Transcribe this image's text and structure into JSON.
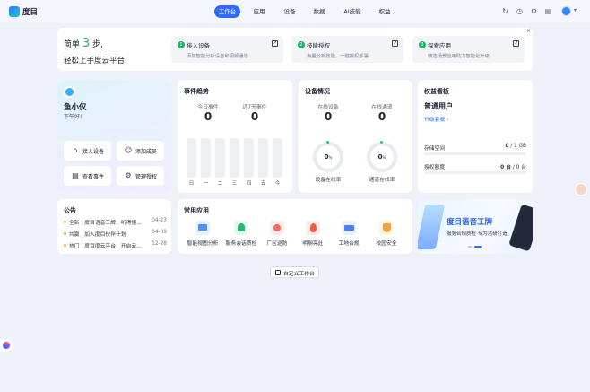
{
  "app": {
    "name": "度目"
  },
  "nav": {
    "items": [
      {
        "label": "工作台",
        "active": true
      },
      {
        "label": "应用"
      },
      {
        "label": "设备"
      },
      {
        "label": "数据"
      },
      {
        "label": "AI技能"
      },
      {
        "label": "权益"
      }
    ]
  },
  "onboarding": {
    "headline_pre": "简单",
    "headline_num": "3",
    "headline_post": "步,",
    "headline_line2": "轻松上手度云平台",
    "steps": [
      {
        "num": "1",
        "title": "接入设备",
        "desc": "添加智能分析设备和视频通道"
      },
      {
        "num": "2",
        "title": "技能授权",
        "desc": "海量分析技能，一键授权部署"
      },
      {
        "num": "3",
        "title": "探索应用",
        "desc": "精选场景应用助力智能化升级"
      }
    ]
  },
  "profile": {
    "name": "鱼小仅",
    "greeting": "下午好!",
    "buttons": [
      "接入设备",
      "添加成员",
      "查看事件",
      "管理授权"
    ]
  },
  "events": {
    "title": "事件趋势",
    "today_label": "今日事件",
    "today_value": "0",
    "week_label": "近7天事件",
    "week_value": "0",
    "days": [
      "日",
      "一",
      "二",
      "三",
      "四",
      "五",
      "今"
    ],
    "daily_counts": [
      0,
      0,
      0,
      0,
      0,
      0,
      0
    ]
  },
  "devices": {
    "title": "设备情况",
    "online_device_label": "在线设备",
    "online_device_value": "0",
    "online_channel_label": "在线通道",
    "online_channel_value": "0",
    "device_rate_value": "0",
    "device_rate_unit": "%",
    "device_rate_label": "设备在线率",
    "channel_rate_value": "0",
    "channel_rate_unit": "%",
    "channel_rate_label": "通道在线率"
  },
  "rights": {
    "title": "权益看板",
    "user_type": "普通用户",
    "upgrade": "升级套餐 ›",
    "storage_label": "存储空间",
    "storage_value": "0",
    "storage_total": "/ 1 GB",
    "storage_fraction": 0,
    "auth_label": "授权额度",
    "auth_value": "0 台",
    "auth_total": "/ 0 台",
    "auth_fraction": 0
  },
  "announcements": {
    "title": "公告",
    "items": [
      {
        "text": "全新 | 度目语音工牌，听得懂...",
        "date": "04-23"
      },
      {
        "text": "共赢 | 加入度目伙伴计划",
        "date": "04-09"
      },
      {
        "text": "热门 | 度目度云平台，开启云...",
        "date": "12-28"
      }
    ]
  },
  "apps": {
    "title": "常用应用",
    "items": [
      "智能视图分析",
      "服务会话质检",
      "厂区巡防",
      "明厨亮灶",
      "工地合规",
      "校园安全"
    ]
  },
  "banner": {
    "title": "度目语音工牌",
    "subtitle": "服务合规质检 专为活研打造"
  },
  "customize": {
    "label": "自定义工作台"
  },
  "colors": {
    "primary": "#2f6bff",
    "success": "#20b26b",
    "background": "#eef1f8"
  }
}
